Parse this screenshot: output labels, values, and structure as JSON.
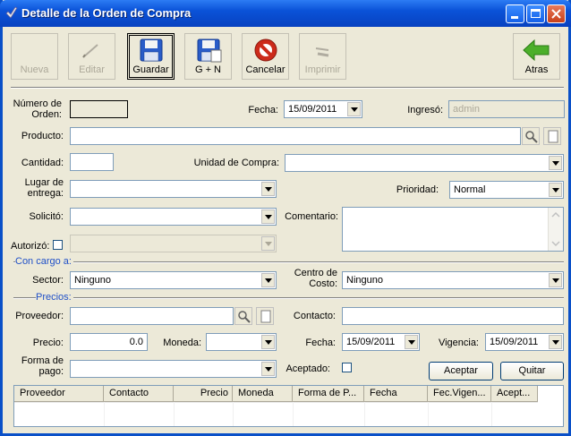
{
  "window": {
    "title": "Detalle de la Orden de Compra"
  },
  "toolbar": {
    "nueva": "Nueva",
    "editar": "Editar",
    "guardar": "Guardar",
    "gn": "G + N",
    "cancelar": "Cancelar",
    "imprimir": "Imprimir",
    "atras": "Atras"
  },
  "form": {
    "numero_label": "Número de Orden:",
    "numero_value": "",
    "fecha_label": "Fecha:",
    "fecha_value": "15/09/2011",
    "ingreso_label": "Ingresó:",
    "ingreso_value": "admin",
    "producto_label": "Producto:",
    "producto_value": "",
    "cantidad_label": "Cantidad:",
    "cantidad_value": "",
    "unidad_label": "Unidad de Compra:",
    "unidad_value": "",
    "lugar_label": "Lugar de entrega:",
    "lugar_value": "",
    "prioridad_label": "Prioridad:",
    "prioridad_value": "Normal",
    "solicito_label": "Solicitó:",
    "solicito_value": "",
    "comentario_label": "Comentario:",
    "comentario_value": "",
    "autorizo_label": "Autorizó:",
    "autorizo_value": ""
  },
  "cargo": {
    "section": "Con cargo a:",
    "sector_label": "Sector:",
    "sector_value": "Ninguno",
    "centro_label": "Centro de Costo:",
    "centro_value": "Ninguno"
  },
  "precios": {
    "section": "Precios:",
    "proveedor_label": "Proveedor:",
    "proveedor_value": "",
    "contacto_label": "Contacto:",
    "contacto_value": "",
    "precio_label": "Precio:",
    "precio_value": "0.0",
    "moneda_label": "Moneda:",
    "moneda_value": "",
    "fecha_label": "Fecha:",
    "fecha_value": "15/09/2011",
    "vigencia_label": "Vigencia:",
    "vigencia_value": "15/09/2011",
    "forma_label": "Forma de pago:",
    "forma_value": "",
    "aceptado_label": "Aceptado:",
    "aceptar_button": "Aceptar",
    "quitar_button": "Quitar"
  },
  "grid": {
    "columns": [
      "Proveedor",
      "Contacto",
      "Precio",
      "Moneda",
      "Forma de P...",
      "Fecha",
      "Fec.Vigen...",
      "Acept..."
    ]
  },
  "colors": {
    "title_bar": "#0a52d8",
    "section_label": "#2050c8",
    "cancel_icon": "#cc2a1a",
    "back_arrow": "#4caf2a"
  }
}
